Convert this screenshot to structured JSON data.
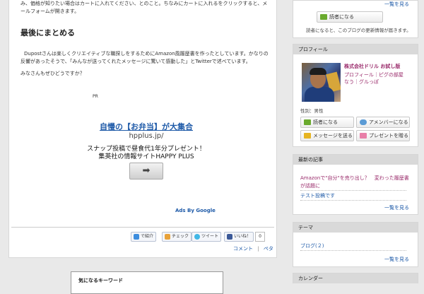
{
  "article": {
    "intro_line1": "み、価格が知りたい場合はカートに入れてください、とのこと。ちなみにカートに入れるをクリックすると、メ",
    "intro_line2": "ールフォームが開きます。",
    "heading": "最後にまとめる",
    "para1_line1": "Dupostさんは楽しくクリエイティブな職探しをするためにAmazon風履歴書を作ったとしています。かなりの",
    "para1_line2": "反響があったそうで、「みんなが送ってくれたメッセージに驚いて感動した」とTwitterで述べています。",
    "para2": "みなさんもぜひどうですか？"
  },
  "ad": {
    "pr_label": "PR",
    "title": "自慢の【お弁当】が大集合",
    "url": "hpplus.jp/",
    "line1": "スナップ投稿で昼食代1年分プレゼント！",
    "line2": "集英社の情報サイトHAPPY PLUS",
    "arrow": "➡",
    "ads_by": "Ads By Google"
  },
  "share": {
    "buttons": [
      {
        "label": "で紹介",
        "icon": "bookmark-icon",
        "color": "#3c8dde"
      },
      {
        "label": "チェック",
        "icon": "check-icon",
        "color": "#e8a23a"
      },
      {
        "label": "ツイート",
        "icon": "twitter-icon",
        "color": "#41b7e6"
      },
      {
        "label": "いいね！",
        "icon": "facebook-icon",
        "color": "#3b5998"
      }
    ],
    "count": "0",
    "comment_link": "コメント",
    "separator": "|",
    "tag_link": "ペタ"
  },
  "keyword_box": {
    "title": "気になるキーワード"
  },
  "sidebar": {
    "reader_section": {
      "more_link": "一覧を見る",
      "reader_button": "読者になる",
      "note": "読者になると、このブログの更新情報が届きます。"
    },
    "profile": {
      "heading": "プロフィール",
      "name": "株式会社ドリル お試し版",
      "links_line1": "プロフィール｜ピグの部屋",
      "links_line2": "なう｜グルっぽ",
      "gender": "性別：男性",
      "buttons": [
        "読者になる",
        "アメンバーになる",
        "メッセージを送る",
        "プレゼントを贈る"
      ]
    },
    "recent": {
      "heading": "最新の記事",
      "item1_line1": "Amazonで\"自分\"を売り出し？　変わった履歴書",
      "item1_line2": "が話題に",
      "item2": "テスト投稿です",
      "more_link": "一覧を見る"
    },
    "theme": {
      "heading": "テーマ",
      "item": "ブログ(２)",
      "more_link": "一覧を見る"
    },
    "calendar": {
      "heading": "カレンダー"
    }
  }
}
